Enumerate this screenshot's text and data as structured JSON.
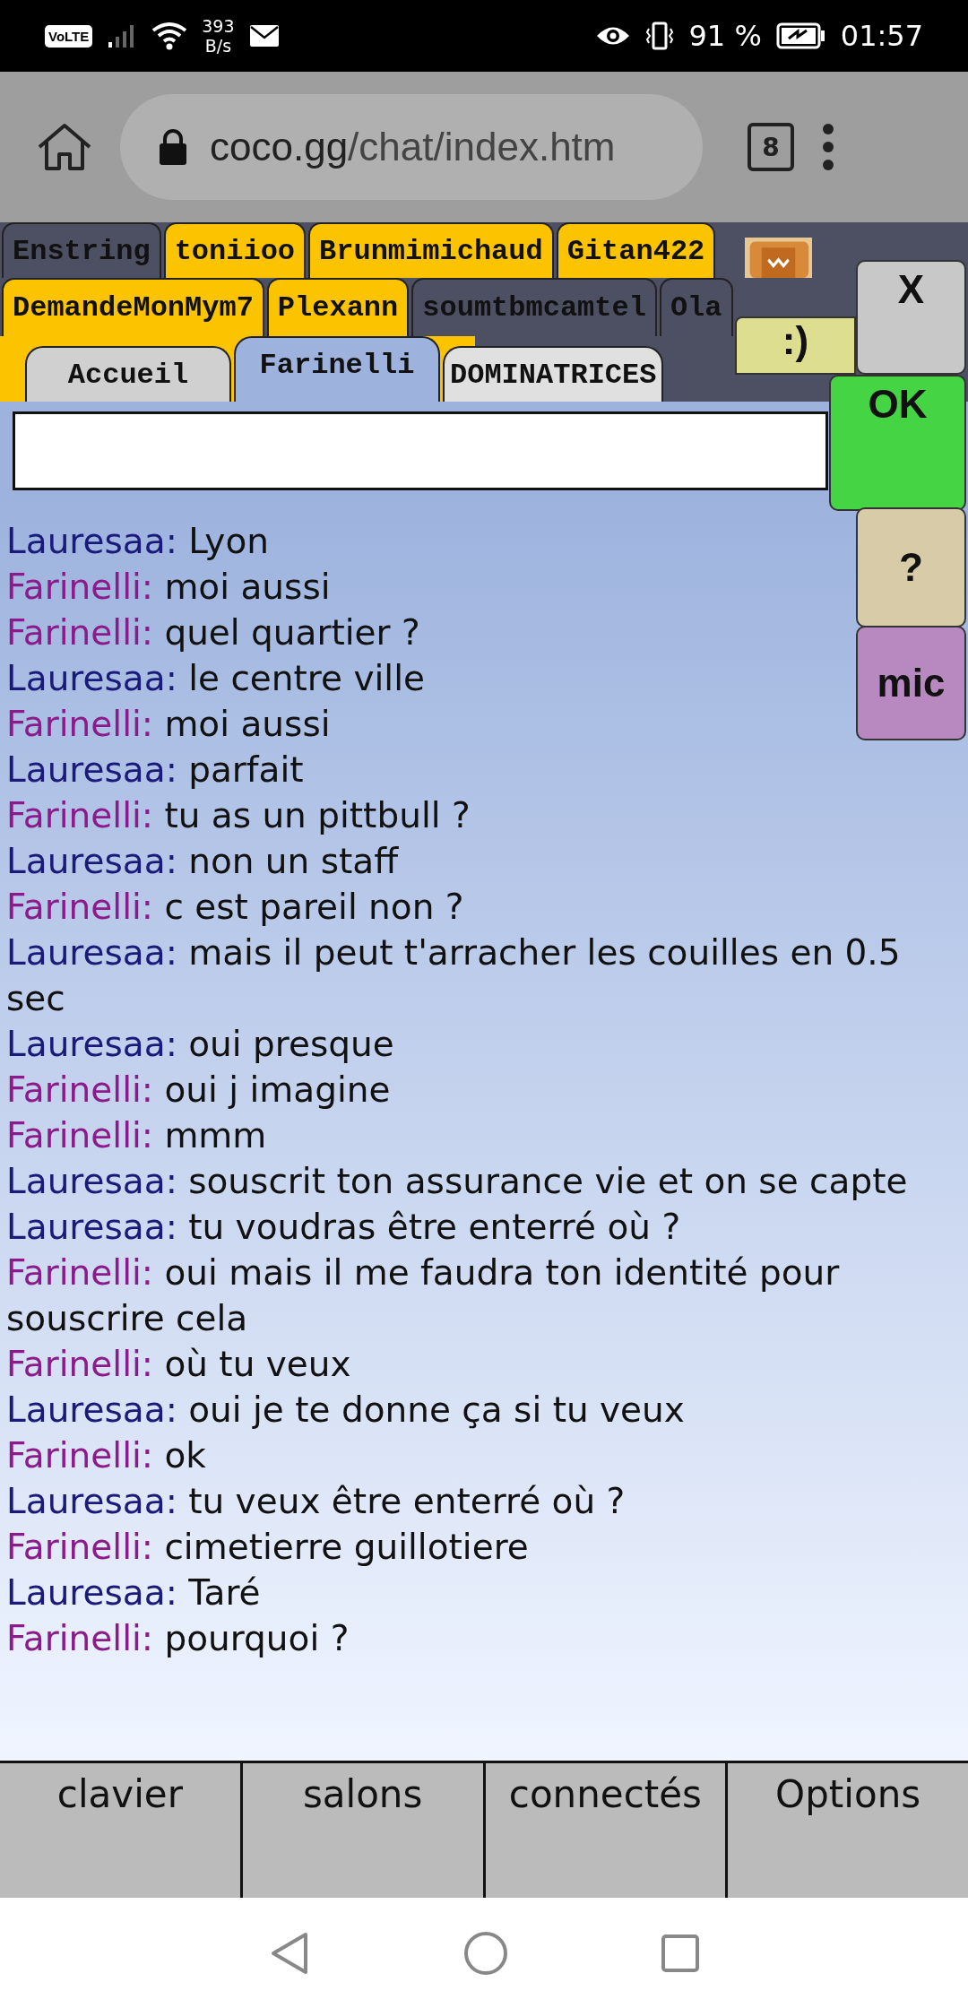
{
  "status_bar": {
    "volte": "VoLTE",
    "speed_value": "393",
    "speed_unit": "B/s",
    "battery": "91 %",
    "time": "01:57"
  },
  "browser": {
    "url_host": "coco.gg",
    "url_path": "/chat/index.htm",
    "tab_count": "8"
  },
  "tab_rows": [
    [
      {
        "label": "Enstring",
        "highlighted": false
      },
      {
        "label": "toniioo",
        "highlighted": true
      },
      {
        "label": "Brunmimichaud",
        "highlighted": true
      },
      {
        "label": "Gitan422",
        "highlighted": true
      }
    ],
    [
      {
        "label": "DemandeMonMym7",
        "highlighted": true
      },
      {
        "label": "Plexann",
        "highlighted": true
      },
      {
        "label": "soumtbmcamtel",
        "highlighted": false
      },
      {
        "label": "Ola",
        "highlighted": false
      }
    ]
  ],
  "room_tabs": [
    {
      "label": "Accueil",
      "selected": false
    },
    {
      "label": "Farinelli",
      "selected": true
    },
    {
      "label": "DOMINATRICES",
      "selected": false
    }
  ],
  "side_buttons": {
    "smiley": ":)",
    "close": "X",
    "ok": "OK",
    "help": "?",
    "mic": "mic"
  },
  "messages": [
    {
      "author": "Lauresaa:",
      "text": "Lyon",
      "color": "#1a1a7a"
    },
    {
      "author": "Farinelli:",
      "text": "moi aussi",
      "color": "#8b1a8b"
    },
    {
      "author": "Farinelli:",
      "text": "quel quartier ?",
      "color": "#8b1a8b"
    },
    {
      "author": "Lauresaa:",
      "text": "le centre ville",
      "color": "#1a1a7a"
    },
    {
      "author": "Farinelli:",
      "text": "moi aussi",
      "color": "#8b1a8b"
    },
    {
      "author": "Lauresaa:",
      "text": "parfait",
      "color": "#1a1a7a"
    },
    {
      "author": "Farinelli:",
      "text": "tu as un pittbull ?",
      "color": "#8b1a8b"
    },
    {
      "author": "Lauresaa:",
      "text": "non un staff",
      "color": "#1a1a7a"
    },
    {
      "author": "Farinelli:",
      "text": "c est pareil non ?",
      "color": "#8b1a8b"
    },
    {
      "author": "Lauresaa:",
      "text": "mais il peut t'arracher les couilles en 0.5 sec",
      "color": "#1a1a7a"
    },
    {
      "author": "Lauresaa:",
      "text": "oui presque",
      "color": "#1a1a7a"
    },
    {
      "author": "Farinelli:",
      "text": "oui j imagine",
      "color": "#8b1a8b"
    },
    {
      "author": "Farinelli:",
      "text": "mmm",
      "color": "#8b1a8b"
    },
    {
      "author": "Lauresaa:",
      "text": "souscrit ton assurance vie et on se capte",
      "color": "#1a1a7a"
    },
    {
      "author": "Lauresaa:",
      "text": "tu voudras être enterré où ?",
      "color": "#1a1a7a"
    },
    {
      "author": "Farinelli:",
      "text": "oui mais il me faudra ton identité pour souscrire cela",
      "color": "#8b1a8b"
    },
    {
      "author": "Farinelli:",
      "text": "où tu veux",
      "color": "#8b1a8b"
    },
    {
      "author": "Lauresaa:",
      "text": "oui je te donne ça si tu veux",
      "color": "#1a1a7a"
    },
    {
      "author": "Farinelli:",
      "text": "ok",
      "color": "#8b1a8b"
    },
    {
      "author": "Lauresaa:",
      "text": "tu veux être enterré où ?",
      "color": "#1a1a7a"
    },
    {
      "author": "Farinelli:",
      "text": "cimetierre guillotiere",
      "color": "#8b1a8b"
    },
    {
      "author": "Lauresaa:",
      "text": "Taré",
      "color": "#1a1a7a"
    },
    {
      "author": "Farinelli:",
      "text": "pourquoi ?",
      "color": "#8b1a8b"
    }
  ],
  "bottom_buttons": [
    "clavier",
    "salons",
    "connectés",
    "Options"
  ]
}
